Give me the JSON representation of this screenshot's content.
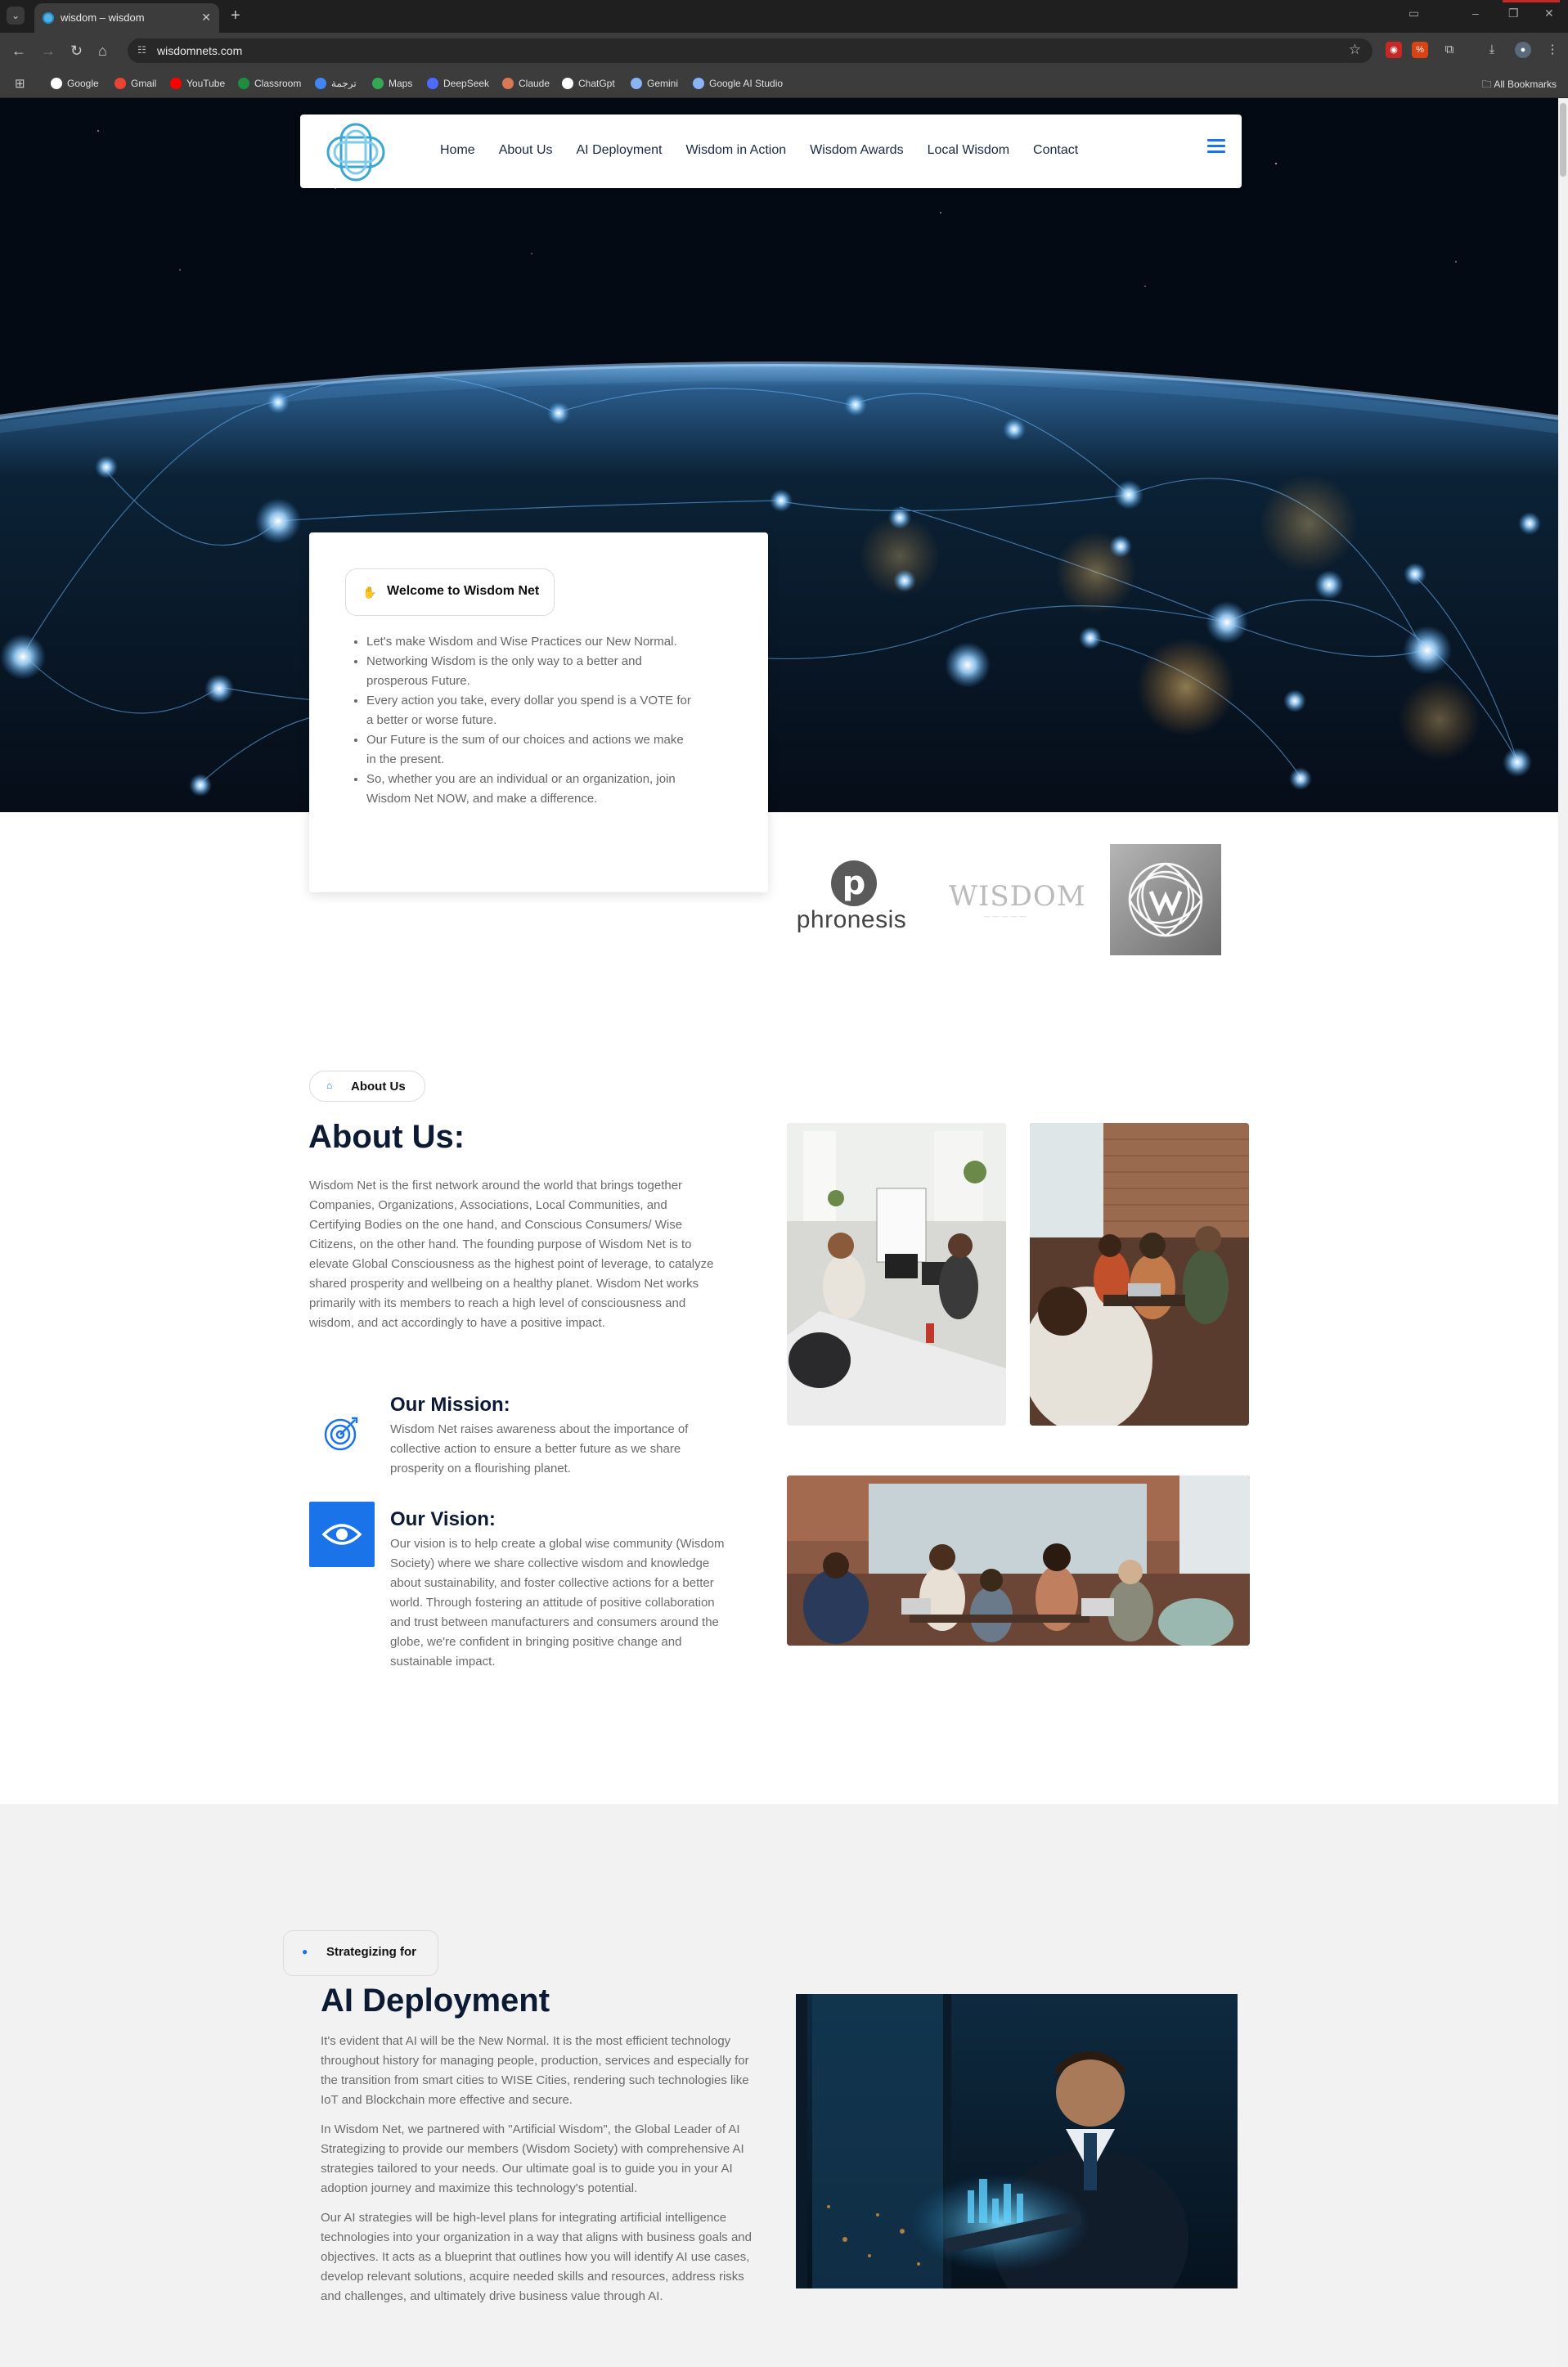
{
  "browser": {
    "tab_title": "wisdom – wisdom",
    "url": "wisdomnets.com",
    "bookmarks": [
      {
        "label": "Google",
        "color": "#ffffff"
      },
      {
        "label": "Gmail",
        "color": "#ea4335"
      },
      {
        "label": "YouTube",
        "color": "#ff0000"
      },
      {
        "label": "Classroom",
        "color": "#1e8e3e"
      },
      {
        "label": "ترجمة",
        "color": "#4285f4"
      },
      {
        "label": "Maps",
        "color": "#34a853"
      },
      {
        "label": "DeepSeek",
        "color": "#4d6bfe"
      },
      {
        "label": "Claude",
        "color": "#d97757"
      },
      {
        "label": "ChatGpt",
        "color": "#ffffff"
      },
      {
        "label": "Gemini",
        "color": "#8ab4f8"
      },
      {
        "label": "Google AI Studio",
        "color": "#8ab4f8"
      }
    ],
    "all_bookmarks": "All Bookmarks"
  },
  "nav": {
    "links": [
      "Home",
      "About Us",
      "AI Deployment",
      "Wisdom in Action",
      "Wisdom Awards",
      "Local Wisdom",
      "Contact"
    ]
  },
  "welcome": {
    "title": "Welcome to Wisdom Net",
    "items": [
      "Let's make Wisdom and Wise Practices our New Normal.",
      "Networking Wisdom is the only way to a better and prosperous Future.",
      "Every action you take, every dollar you spend is a VOTE for a better or worse future.",
      "Our Future is the sum of our choices and actions we make in the present.",
      "So, whether you are an individual or an organization, join Wisdom Net NOW, and make a difference."
    ]
  },
  "partners": {
    "phronesis": "phronesis",
    "wisdom": "WISDOM"
  },
  "about": {
    "pill": "About Us",
    "title": "About Us:",
    "text": "Wisdom Net is the first network around the world that brings together Companies, Organizations, Associations, Local Communities, and Certifying Bodies on the one hand, and Conscious Consumers/ Wise Citizens, on the other hand. The founding purpose of Wisdom Net is to elevate Global Consciousness as the highest point of leverage, to catalyze shared prosperity and wellbeing on a healthy planet. Wisdom Net works primarily with its members to reach a high level of consciousness and wisdom, and act accordingly to have a positive impact.",
    "mission_title": "Our Mission:",
    "mission_text": "Wisdom Net raises awareness about the importance of collective action to ensure a better future as we share prosperity on a flourishing planet.",
    "vision_title": "Our Vision:",
    "vision_text": "Our vision is to help create a global wise community (Wisdom Society) where we share collective wisdom and knowledge about sustainability, and foster collective actions for a better world. Through fostering an attitude of positive collaboration and trust between manufacturers and consumers around the globe, we're confident in bringing positive change and sustainable impact."
  },
  "ai": {
    "pill": "Strategizing for",
    "title": "AI Deployment",
    "p1": "It's evident that AI will be the New Normal. It is the most efficient technology throughout history for managing people, production, services and especially for the transition from smart cities to WISE Cities, rendering such technologies like IoT and Blockchain more effective and secure.",
    "p2": "In Wisdom Net, we partnered with \"Artificial Wisdom\", the Global Leader of AI Strategizing to provide our members (Wisdom Society) with comprehensive AI strategies tailored to your needs. Our ultimate goal is to guide you in your AI adoption journey and maximize this technology's potential.",
    "p3": "Our AI strategies will be high-level plans for integrating artificial intelligence technologies into your organization in a way that aligns with business goals and objectives. It acts as a blueprint that outlines how you will identify AI use cases, develop relevant solutions, acquire needed skills and resources, address risks and challenges, and ultimately drive business value through AI."
  },
  "colors": {
    "accent": "#1a73e8",
    "heading": "#0d1a33",
    "body_text": "#6b6b6b"
  }
}
